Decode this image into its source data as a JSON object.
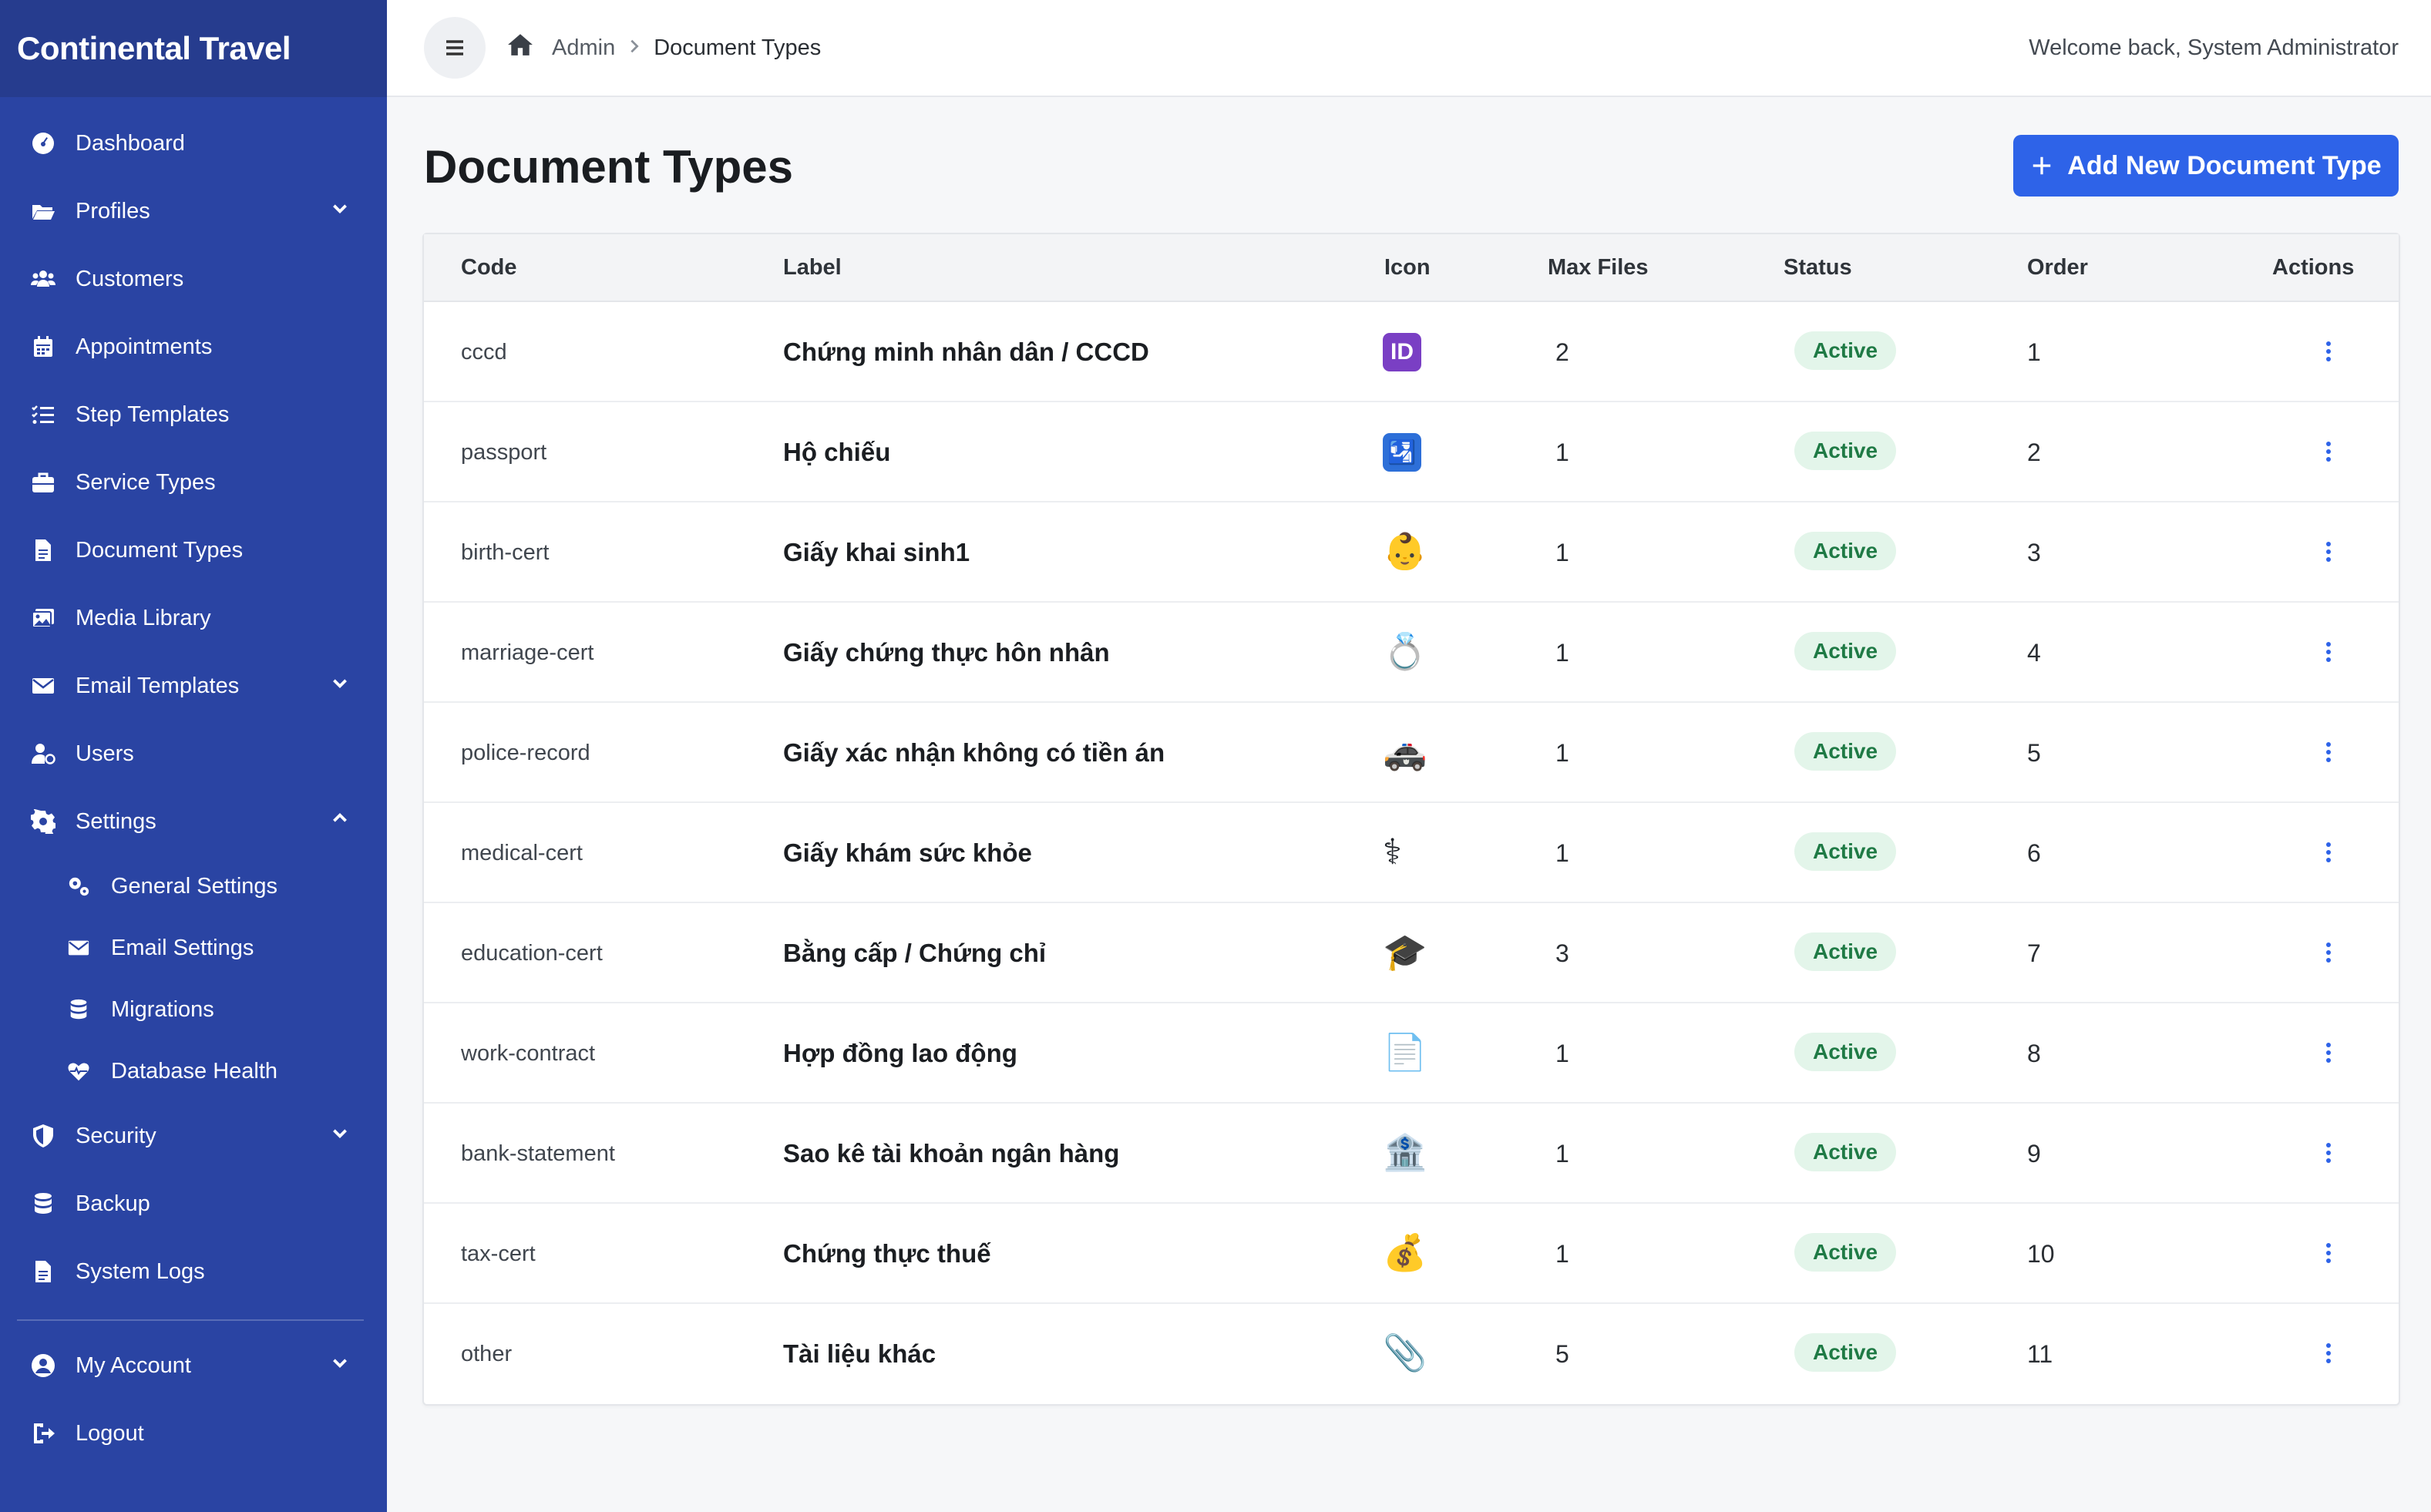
{
  "brand": "Continental Travel",
  "nav": {
    "dashboard": "Dashboard",
    "profiles": "Profiles",
    "customers": "Customers",
    "appointments": "Appointments",
    "step_templates": "Step Templates",
    "service_types": "Service Types",
    "document_types": "Document Types",
    "media_library": "Media Library",
    "email_templates": "Email Templates",
    "users": "Users",
    "settings": "Settings",
    "settings_sub": {
      "general": "General Settings",
      "email": "Email Settings",
      "migrations": "Migrations",
      "db_health": "Database Health"
    },
    "security": "Security",
    "backup": "Backup",
    "system_logs": "System Logs",
    "my_account": "My Account",
    "logout": "Logout"
  },
  "topbar": {
    "breadcrumb_admin": "Admin",
    "breadcrumb_current": "Document Types",
    "welcome": "Welcome back, System Administrator"
  },
  "page": {
    "title": "Document Types",
    "add_button": "Add New Document Type"
  },
  "table": {
    "headers": {
      "code": "Code",
      "label": "Label",
      "icon": "Icon",
      "max_files": "Max Files",
      "status": "Status",
      "order": "Order",
      "actions": "Actions"
    },
    "rows": [
      {
        "code": "cccd",
        "label": "Chứng minh nhân dân / CCCD",
        "icon": "id-card-icon",
        "max_files": "2",
        "status": "Active",
        "order": "1"
      },
      {
        "code": "passport",
        "label": "Hộ chiếu",
        "icon": "passport-control-icon",
        "max_files": "1",
        "status": "Active",
        "order": "2"
      },
      {
        "code": "birth-cert",
        "label": "Giấy khai sinh1",
        "icon": "baby-face-icon",
        "max_files": "1",
        "status": "Active",
        "order": "3"
      },
      {
        "code": "marriage-cert",
        "label": "Giấy chứng thực hôn nhân",
        "icon": "ring-icon",
        "max_files": "1",
        "status": "Active",
        "order": "4"
      },
      {
        "code": "police-record",
        "label": "Giấy xác nhận không có tiền án",
        "icon": "police-car-icon",
        "max_files": "1",
        "status": "Active",
        "order": "5"
      },
      {
        "code": "medical-cert",
        "label": "Giấy khám sức khỏe",
        "icon": "medical-symbol-icon",
        "max_files": "1",
        "status": "Active",
        "order": "6"
      },
      {
        "code": "education-cert",
        "label": "Bằng cấp / Chứng chỉ",
        "icon": "graduation-cap-icon",
        "max_files": "3",
        "status": "Active",
        "order": "7"
      },
      {
        "code": "work-contract",
        "label": "Hợp đồng lao động",
        "icon": "document-icon",
        "max_files": "1",
        "status": "Active",
        "order": "8"
      },
      {
        "code": "bank-statement",
        "label": "Sao kê tài khoản ngân hàng",
        "icon": "bank-icon",
        "max_files": "1",
        "status": "Active",
        "order": "9"
      },
      {
        "code": "tax-cert",
        "label": "Chứng thực thuế",
        "icon": "money-bag-icon",
        "max_files": "1",
        "status": "Active",
        "order": "10"
      },
      {
        "code": "other",
        "label": "Tài liệu khác",
        "icon": "paperclip-icon",
        "max_files": "5",
        "status": "Active",
        "order": "11"
      }
    ]
  },
  "colors": {
    "sidebar": "#2a44a3",
    "brand_bar": "#263c8e",
    "accent": "#2e63e8",
    "badge_bg": "#e3f5ea",
    "badge_text": "#1f7a45"
  }
}
